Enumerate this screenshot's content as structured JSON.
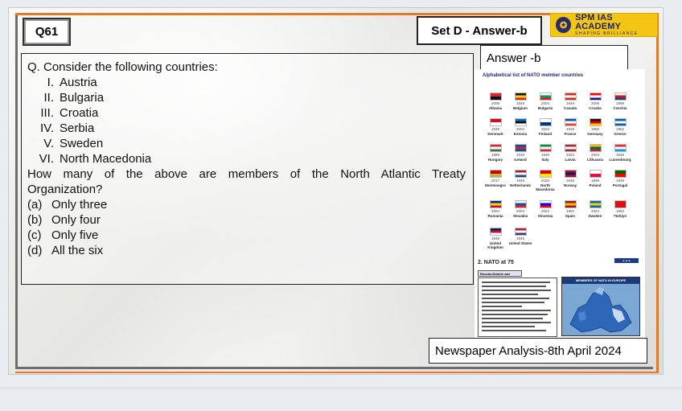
{
  "header": {
    "question_number": "Q61",
    "set_label": "Set D - Answer-b",
    "logo_text": "SPM IAS ACADEMY",
    "logo_tagline": "SHAPING BRILLIANCE"
  },
  "question": {
    "intro": "Q. Consider the following countries:",
    "countries": [
      {
        "num": "I.",
        "name": "Austria"
      },
      {
        "num": "II.",
        "name": "Bulgaria"
      },
      {
        "num": "III.",
        "name": "Croatia"
      },
      {
        "num": "IV.",
        "name": "Serbia"
      },
      {
        "num": "V.",
        "name": "Sweden"
      },
      {
        "num": "VI.",
        "name": "North Macedonia"
      }
    ],
    "stem_line1": "How many of the above are members of the North Atlantic Treaty",
    "stem_line2": "Organization?",
    "options": [
      {
        "label": "(a)",
        "text": "Only three"
      },
      {
        "label": "(b)",
        "text": "Only four"
      },
      {
        "label": "(c)",
        "text": "Only five"
      },
      {
        "label": "(d)",
        "text": "All the six"
      }
    ]
  },
  "answer": {
    "label": "Answer -b"
  },
  "nato_list": {
    "title": "Alphabetical list of NATO member countries",
    "members": [
      {
        "year": "2009",
        "name": "Albania",
        "colors": [
          "#d62828",
          "#111111"
        ]
      },
      {
        "year": "1949",
        "name": "Belgium",
        "colors": [
          "#111111",
          "#f4d000",
          "#d62828"
        ]
      },
      {
        "year": "2004",
        "name": "Bulgaria",
        "colors": [
          "#ffffff",
          "#00966e",
          "#d62612"
        ]
      },
      {
        "year": "1949",
        "name": "Canada",
        "colors": [
          "#d52b1e",
          "#ffffff",
          "#d52b1e"
        ]
      },
      {
        "year": "2009",
        "name": "Croatia",
        "colors": [
          "#ff0000",
          "#ffffff",
          "#171796"
        ]
      },
      {
        "year": "1999",
        "name": "Czechia",
        "colors": [
          "#ffffff",
          "#d7141a",
          "#11457e"
        ]
      },
      {
        "year": "1949",
        "name": "Denmark",
        "colors": [
          "#c8102e",
          "#ffffff"
        ]
      },
      {
        "year": "2004",
        "name": "Estonia",
        "colors": [
          "#0072ce",
          "#111111",
          "#ffffff"
        ]
      },
      {
        "year": "2023",
        "name": "Finland",
        "colors": [
          "#ffffff",
          "#003580"
        ]
      },
      {
        "year": "1949",
        "name": "France",
        "colors": [
          "#0055a4",
          "#ffffff",
          "#ef4135"
        ]
      },
      {
        "year": "1955",
        "name": "Germany",
        "colors": [
          "#111111",
          "#dd0000",
          "#ffce00"
        ]
      },
      {
        "year": "1952",
        "name": "Greece",
        "colors": [
          "#0d5eaf",
          "#ffffff",
          "#0d5eaf"
        ]
      },
      {
        "year": "1999",
        "name": "Hungary",
        "colors": [
          "#cd2a3e",
          "#ffffff",
          "#436f4d"
        ]
      },
      {
        "year": "1949",
        "name": "Iceland",
        "colors": [
          "#02529c",
          "#dc1e35",
          "#02529c"
        ]
      },
      {
        "year": "1949",
        "name": "Italy",
        "colors": [
          "#009246",
          "#ffffff",
          "#ce2b37"
        ]
      },
      {
        "year": "2004",
        "name": "Latvia",
        "colors": [
          "#9e3039",
          "#ffffff",
          "#9e3039"
        ]
      },
      {
        "year": "2004",
        "name": "Lithuania",
        "colors": [
          "#fdb913",
          "#006a44",
          "#c1272d"
        ]
      },
      {
        "year": "1949",
        "name": "Luxembourg",
        "colors": [
          "#ed2939",
          "#ffffff",
          "#00a1de"
        ]
      },
      {
        "year": "2017",
        "name": "Montenegro",
        "colors": [
          "#c40308",
          "#d4af37"
        ]
      },
      {
        "year": "1949",
        "name": "Netherlands",
        "colors": [
          "#ae1c28",
          "#ffffff",
          "#21468b"
        ]
      },
      {
        "year": "2020",
        "name": "North Macedonia",
        "colors": [
          "#d20000",
          "#ffe600"
        ]
      },
      {
        "year": "1949",
        "name": "Norway",
        "colors": [
          "#ba0c2f",
          "#00205b",
          "#ba0c2f"
        ]
      },
      {
        "year": "1999",
        "name": "Poland",
        "colors": [
          "#ffffff",
          "#dc143c"
        ]
      },
      {
        "year": "1949",
        "name": "Portugal",
        "colors": [
          "#006600",
          "#ff0000"
        ]
      },
      {
        "year": "2004",
        "name": "Romania",
        "colors": [
          "#002b7f",
          "#fcd116",
          "#ce1126"
        ]
      },
      {
        "year": "2004",
        "name": "Slovakia",
        "colors": [
          "#ffffff",
          "#0b4ea2",
          "#ee1c25"
        ]
      },
      {
        "year": "2004",
        "name": "Slovenia",
        "colors": [
          "#ffffff",
          "#0000ff",
          "#ff0000"
        ]
      },
      {
        "year": "1982",
        "name": "Spain",
        "colors": [
          "#aa151b",
          "#f1bf00",
          "#aa151b"
        ]
      },
      {
        "year": "2024",
        "name": "Sweden",
        "colors": [
          "#006aa7",
          "#fecc00",
          "#006aa7"
        ]
      },
      {
        "year": "1952",
        "name": "Türkiye",
        "colors": [
          "#e30a17",
          "#e30a17"
        ]
      },
      {
        "year": "1949",
        "name": "United Kingdom",
        "colors": [
          "#012169",
          "#c8102e",
          "#ffffff"
        ]
      },
      {
        "year": "1949",
        "name": "United States",
        "colors": [
          "#b22234",
          "#ffffff",
          "#3c3b6e"
        ]
      }
    ]
  },
  "nato75": {
    "title": "2.  NATO at 75",
    "subheading": "Russia-Ukraine war",
    "map_title": "MEMBERS OF NATO IN EUROPE"
  },
  "footer": {
    "source_label": "Newspaper Analysis-8th April  2024"
  }
}
